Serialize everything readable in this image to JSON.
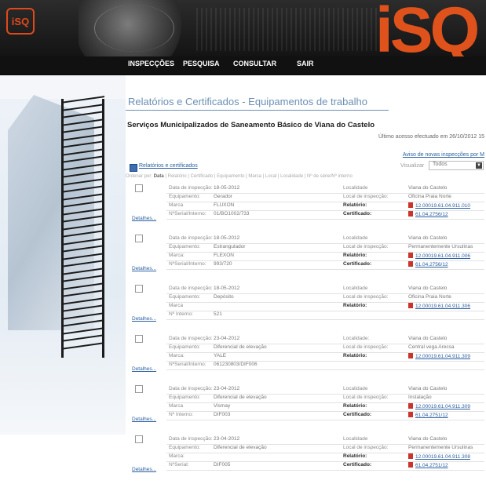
{
  "header": {
    "logo_small": "iSQ",
    "logo_big": "iSQ",
    "nav": [
      "INSPECÇÕES",
      "PESQUISA",
      "CONSULTAR",
      "SAIR"
    ]
  },
  "colors": {
    "accent": "#e0521c",
    "link": "#2a5fa0",
    "title": "#6c8fb5"
  },
  "main": {
    "title": "Relatórios e Certificados - Equipamentos de trabalho",
    "organization": "Serviços Municipalizados de Saneamento Básico de Viana do Castelo",
    "last_access": "Último acesso efectuado em 26/10/2012 15",
    "notice_link": "Aviso de novas inspecções por M",
    "section_label": "Relatórios e certificados",
    "visualizar_label": "Visualizar",
    "visualizar_value": "Todos",
    "sort_prefix": "Ordenar por:",
    "sort_active": "Data",
    "sort_rest": "| Relatório | Certificado | Equipamento | Marca | Local | Localidade | Nº de série/Nº interno"
  },
  "records": [
    {
      "details": "Detalhes...",
      "rows": [
        [
          "Data de inspecção:",
          "18-05-2012",
          "Localidade",
          "Viana do Castelo"
        ],
        [
          "Equipamento:",
          "Gerador",
          "Local de inspecção:",
          "Oficina Praia Norte"
        ],
        [
          "Marca",
          "FLUXON",
          "Relatório:",
          "12.00019.61.04.911.010"
        ],
        [
          "NºSerial/Interno:",
          "01/BO1002/733",
          "Certificado:",
          "61.04.2756/12"
        ]
      ]
    },
    {
      "details": "Detalhes...",
      "rows": [
        [
          "Data de inspecção:",
          "18-05-2012",
          "Localidade",
          "Viana do Castelo"
        ],
        [
          "Equipamento:",
          "Estrangulador",
          "Local de inspecção:",
          "Permanentemente Ursulinas"
        ],
        [
          "Marca:",
          "FLEXON",
          "Relatório:",
          "12.00019.61.04.911.006"
        ],
        [
          "NºSerial/Interno:",
          "993/720",
          "Certificado:",
          "61.04.2756/12"
        ]
      ]
    },
    {
      "details": "Detalhes...",
      "rows": [
        [
          "Data de inspecção:",
          "18-05-2012",
          "Localidade",
          "Viana do Castelo"
        ],
        [
          "Equipamento:",
          "Depósito",
          "Local de inspecção:",
          "Oficina Praia Norte"
        ],
        [
          "Marca",
          "",
          "Relatório:",
          "12.00019.61.04.911.306"
        ],
        [
          "Nº Interno:",
          "521",
          "",
          ""
        ]
      ]
    },
    {
      "details": "Detalhes...",
      "rows": [
        [
          "Data de inspecção:",
          "23-04-2012",
          "Localidade:",
          "Viana do Castelo"
        ],
        [
          "Equipamento:",
          "Diferencial de elevação",
          "Local de inspecção:",
          "Central vega Arecsa"
        ],
        [
          "Marca:",
          "YALE",
          "Relatório:",
          "12.00019.61.04.911.309"
        ],
        [
          "NºSerial/Interno:",
          "061230803/DIF006",
          "",
          ""
        ]
      ]
    },
    {
      "details": "Detalhes...",
      "rows": [
        [
          "Data de inspecção:",
          "23-04-2012",
          "Localidade",
          "Viana do Castelo"
        ],
        [
          "Equipamento:",
          "Diferencial de elevação",
          "Local de inspecção:",
          "Instalação"
        ],
        [
          "Marca",
          "Vismay",
          "Relatório:",
          "12.00019.61.04.911.309"
        ],
        [
          "Nº Interno:",
          "DIF003",
          "Certificado:",
          "61.04.2751/12"
        ]
      ]
    },
    {
      "details": "Detalhes...",
      "rows": [
        [
          "Data de inspecção:",
          "23-04-2012",
          "Localidade",
          "Viana do Castelo"
        ],
        [
          "Equipamento:",
          "Diferencial de elevação",
          "Local de inspecção:",
          "Permanentemente Ursulinas"
        ],
        [
          "Marca:",
          "",
          "Relatório:",
          "12.00019.61.04.911.308"
        ],
        [
          "NºSerial:",
          "DIF005",
          "Certificado:",
          "61.04.2751/12"
        ]
      ]
    }
  ]
}
